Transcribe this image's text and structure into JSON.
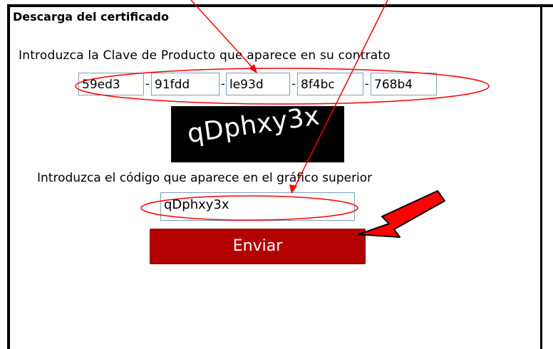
{
  "title": "Descarga del certificado",
  "instruction_key": "Introduzca la Clave de Producto que aparece en su contrato",
  "product_key": [
    "59ed3",
    "91fdd",
    "le93d",
    "8f4bc",
    "768b4"
  ],
  "separator": "-",
  "captcha_text": "qDphxy3x",
  "instruction_code": "Introduzca el código que aparece en el gráfico superior",
  "code_value": "qDphxy3x",
  "submit_label": "Enviar",
  "colors": {
    "button": "#b30000",
    "annotation": "#ff0000",
    "input_border": "#7f9db9"
  }
}
